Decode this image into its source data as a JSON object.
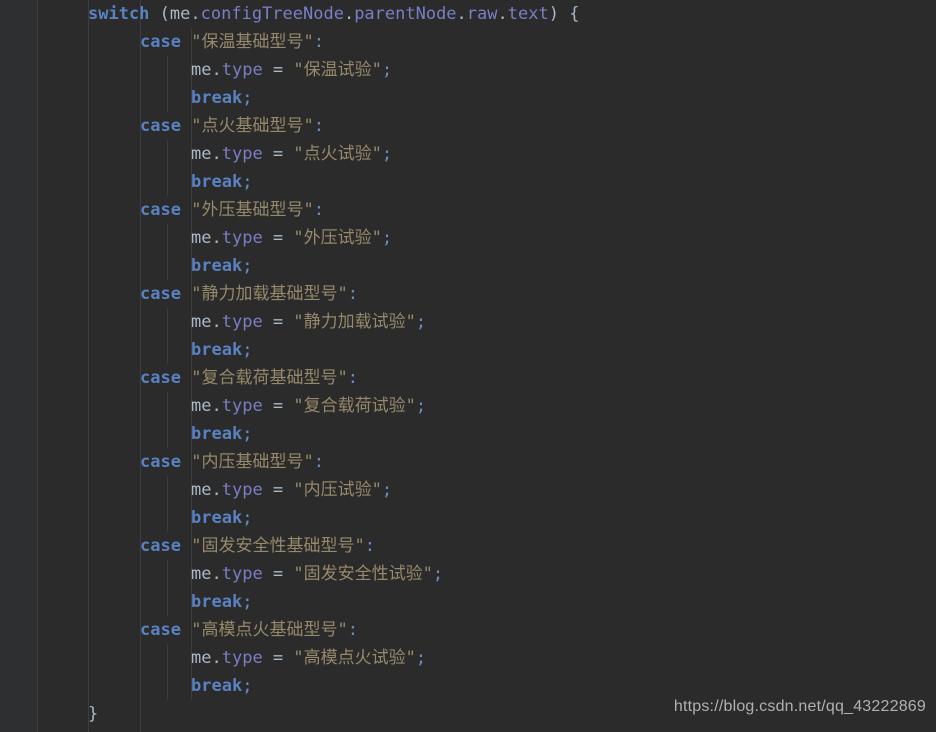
{
  "editor": {
    "theme_background": "#2b2b2b",
    "gutter_background": "#313335",
    "indent_guide_color": "#3b3f41",
    "colors": {
      "keyword": "#5a81c2",
      "plain_text": "#a9b7c6",
      "property": "#7a7ec4",
      "string": "#96886a",
      "punctuation": "#6a8fc4"
    },
    "language": "javascript"
  },
  "code": {
    "switch_keyword": "switch",
    "switch_open_paren": " (",
    "switch_object": "me",
    "dot": ".",
    "switch_prop_1": "configTreeNode",
    "switch_prop_2": "parentNode",
    "switch_prop_3": "raw",
    "switch_prop_4": "text",
    "switch_close": ") {",
    "case_keyword": "case",
    "break_keyword": "break",
    "semicolon": ";",
    "colon": ":",
    "assign_object": "me",
    "assign_prop": "type",
    "assign_operator": " = ",
    "quote": "\"",
    "closing_brace": "}",
    "cases": [
      {
        "match": "保温基础型号",
        "assign": "保温试验"
      },
      {
        "match": "点火基础型号",
        "assign": "点火试验"
      },
      {
        "match": "外压基础型号",
        "assign": "外压试验"
      },
      {
        "match": "静力加载基础型号",
        "assign": "静力加载试验"
      },
      {
        "match": "复合载荷基础型号",
        "assign": "复合载荷试验"
      },
      {
        "match": "内压基础型号",
        "assign": "内压试验"
      },
      {
        "match": "固发安全性基础型号",
        "assign": "固发安全性试验"
      },
      {
        "match": "高模点火基础型号",
        "assign": "高模点火试验"
      }
    ]
  },
  "watermark": {
    "url": "https://blog.csdn.net/qq_43222869"
  }
}
